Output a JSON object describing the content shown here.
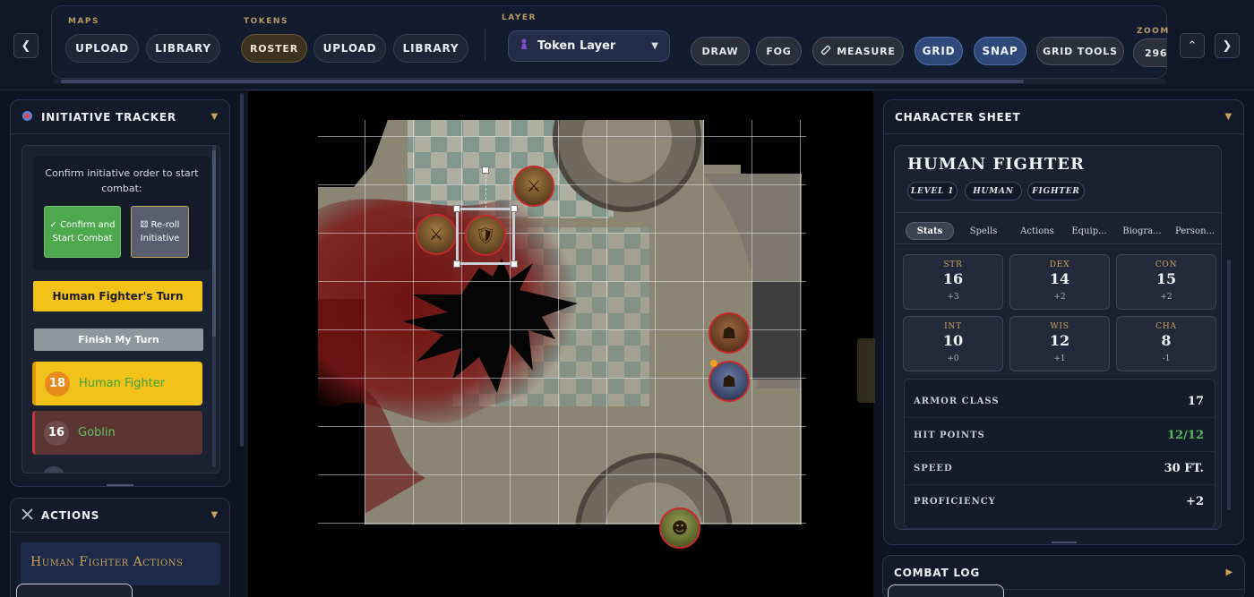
{
  "toolbar": {
    "maps_label": "MAPS",
    "maps_upload": "UPLOAD",
    "maps_library": "LIBRARY",
    "tokens_label": "TOKENS",
    "tokens_roster": "ROSTER",
    "tokens_upload": "UPLOAD",
    "tokens_library": "LIBRARY",
    "layer_label": "LAYER",
    "layer_value": "Token Layer",
    "draw": "DRAW",
    "fog": "FOG",
    "measure": "MEASURE",
    "grid": "GRID",
    "snap": "SNAP",
    "grid_tools": "GRID TOOLS",
    "zoom_label": "ZOOM",
    "zoom_value": "296%"
  },
  "initiative": {
    "title": "INITIATIVE TRACKER",
    "prompt": "Confirm initiative order to start combat:",
    "confirm_button": "✓ Confirm and Start Combat",
    "reroll_button": "Re-roll Initiative",
    "turn_banner": "Human Fighter's Turn",
    "finish_button": "Finish My Turn",
    "entries": [
      {
        "roll": "18",
        "name": "Human Fighter"
      },
      {
        "roll": "16",
        "name": "Goblin"
      }
    ]
  },
  "actions": {
    "title": "ACTIONS",
    "subtitle": "Human Fighter Actions"
  },
  "character_sheet": {
    "title": "CHARACTER SHEET",
    "name": "HUMAN FIGHTER",
    "tags": [
      "LEVEL 1",
      "HUMAN",
      "FIGHTER"
    ],
    "tabs": [
      "Stats",
      "Spells",
      "Actions",
      "Equip...",
      "Biogra...",
      "Person..."
    ],
    "stats": [
      {
        "label": "STR",
        "score": "16",
        "mod": "+3"
      },
      {
        "label": "DEX",
        "score": "14",
        "mod": "+2"
      },
      {
        "label": "CON",
        "score": "15",
        "mod": "+2"
      },
      {
        "label": "INT",
        "score": "10",
        "mod": "+0"
      },
      {
        "label": "WIS",
        "score": "12",
        "mod": "+1"
      },
      {
        "label": "CHA",
        "score": "8",
        "mod": "-1"
      }
    ],
    "combat": [
      {
        "label": "ARMOR CLASS",
        "value": "17"
      },
      {
        "label": "HIT POINTS",
        "value": "12/12"
      },
      {
        "label": "SPEED",
        "value": "30 FT."
      },
      {
        "label": "PROFICIENCY",
        "value": "+2"
      }
    ]
  },
  "combat_log": {
    "title": "COMBAT LOG"
  },
  "colors": {
    "accent_gold": "#c9a256",
    "active_blue": "#2f4a7a",
    "turn_yellow": "#f2c21b",
    "confirm_green": "#4ea84d",
    "token_border": "#c22b2b"
  },
  "icons": {
    "initiative": "d20-icon",
    "actions": "crossed-swords-icon",
    "layer": "pawn-icon",
    "measure": "ruler-icon",
    "reroll": "dice-icon"
  }
}
